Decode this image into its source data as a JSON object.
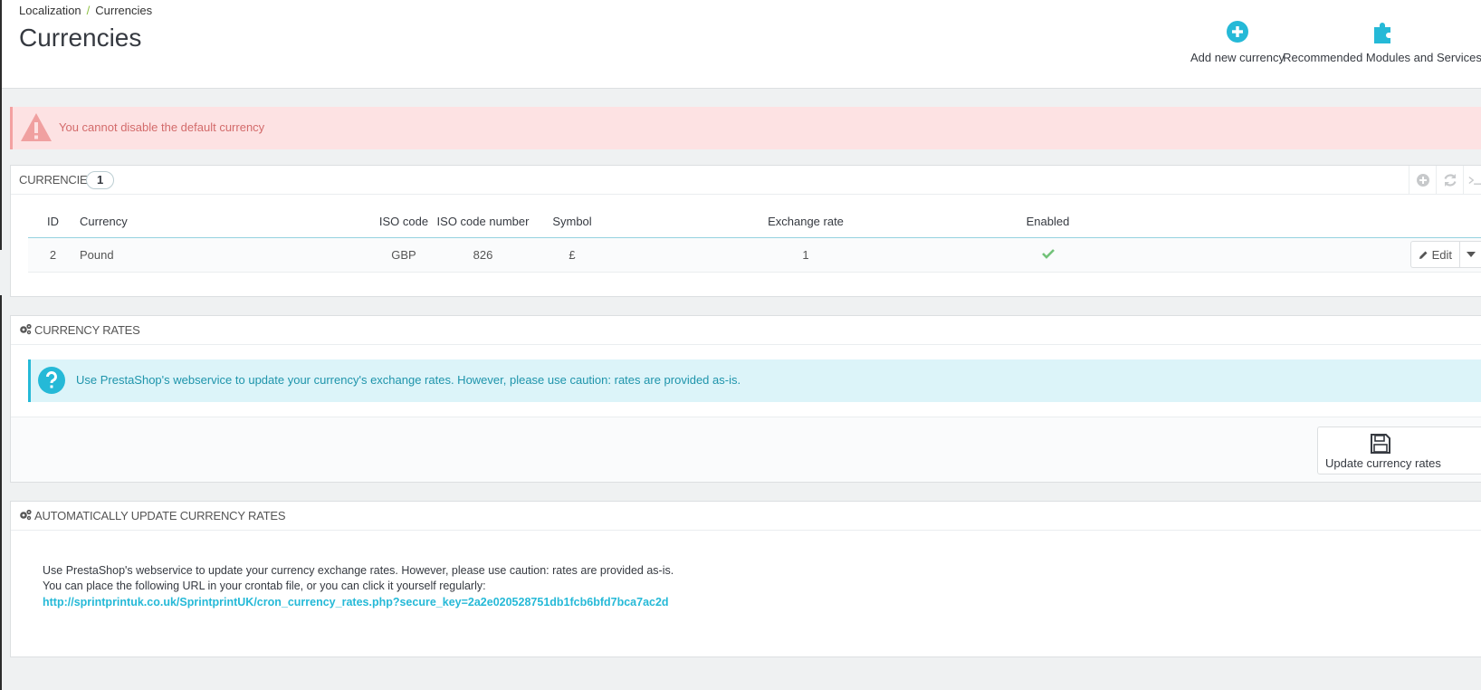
{
  "breadcrumb": {
    "parent": "Localization",
    "separator": "/",
    "current": "Currencies"
  },
  "page_title": "Currencies",
  "toolbar": {
    "add_label": "Add new currency",
    "modules_label": "Recommended Modules and Services"
  },
  "error_alert": {
    "message": "You cannot disable the default currency"
  },
  "currencies_panel": {
    "title": "Currencies",
    "count": "1",
    "columns": [
      "ID",
      "Currency",
      "ISO code",
      "ISO code number",
      "Symbol",
      "Exchange rate",
      "Enabled"
    ],
    "rows": [
      {
        "id": "2",
        "currency": "Pound",
        "iso_code": "GBP",
        "iso_code_number": "826",
        "symbol": "£",
        "exchange_rate": "1",
        "enabled": true,
        "edit_label": "Edit"
      }
    ]
  },
  "rates_panel": {
    "title": "Currency rates",
    "info": "Use PrestaShop's webservice to update your currency's exchange rates. However, please use caution: rates are provided as-is.",
    "update_button": "Update currency rates"
  },
  "auto_panel": {
    "title": "Automatically update currency rates",
    "line1": "Use PrestaShop's webservice to update your currency exchange rates. However, please use caution: rates are provided as-is.",
    "line2": "You can place the following URL in your crontab file, or you can click it yourself regularly:",
    "cron_url": "http://sprintprintuk.co.uk/SprintprintUK/cron_currency_rates.php?secure_key=2a2e020528751db1fcb6bfd7bca7ac2d"
  },
  "colors": {
    "accent": "#25b9d7",
    "danger_bg": "#fde2e3",
    "danger_text": "#d36b6b",
    "info_bg": "#dcf4f9",
    "success": "#72c279"
  }
}
